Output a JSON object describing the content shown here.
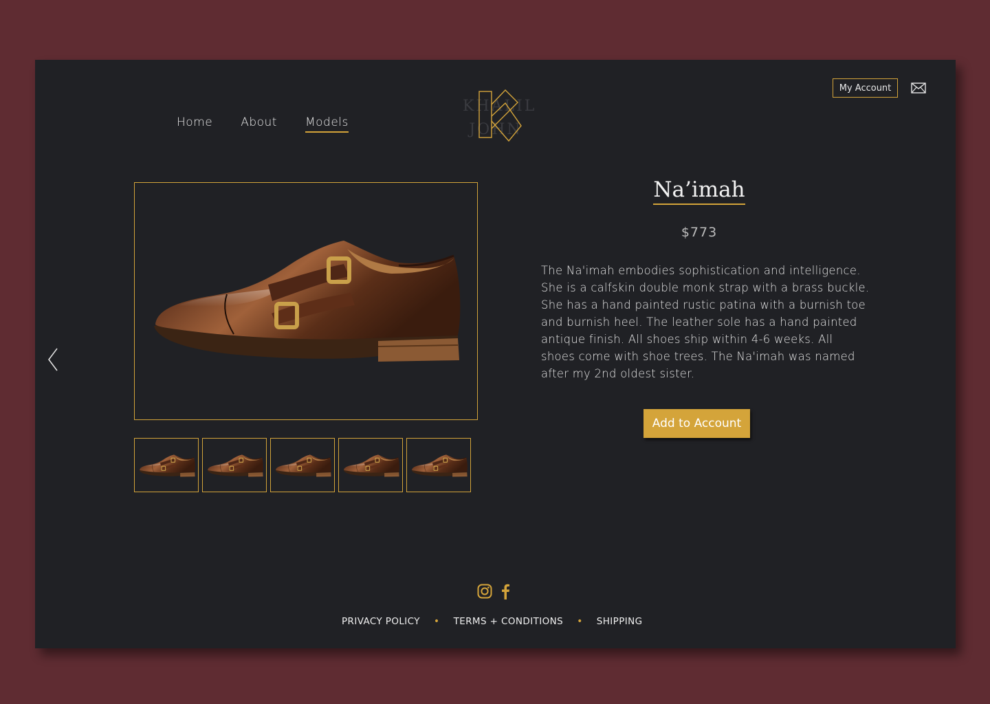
{
  "colors": {
    "background": "#5f2c32",
    "panel": "#202125",
    "accent": "#d4a43a",
    "text": "#e9e9e9"
  },
  "header": {
    "nav": [
      {
        "label": "Home",
        "active": false
      },
      {
        "label": "About",
        "active": false
      },
      {
        "label": "Models",
        "active": true
      }
    ],
    "logo": {
      "icon": "k-monogram-icon",
      "wordmark": "KHALIL\nJOHN"
    },
    "account_label": "My Account",
    "mail_icon": "envelope-icon"
  },
  "gallery": {
    "prev_icon": "chevron-left-icon",
    "main_image": "double-monk-strap-shoe",
    "thumbnail_count": 5
  },
  "product": {
    "name": "Na’imah",
    "price": "$773",
    "description": "The Na'imah embodies sophistication and intelligence. She is a calfskin double monk strap with a brass buckle. She has a hand painted rustic patina with a burnish toe and burnish heel. The leather sole has a hand painted antique finish. All shoes ship within 4-6 weeks. All shoes come with shoe trees. The Na'imah was named after my 2nd oldest sister.",
    "add_button": "Add to Account"
  },
  "footer": {
    "social": [
      "instagram-icon",
      "facebook-icon"
    ],
    "links": [
      "PRIVACY POLICY",
      "TERMS + CONDITIONS",
      "SHIPPING"
    ]
  }
}
